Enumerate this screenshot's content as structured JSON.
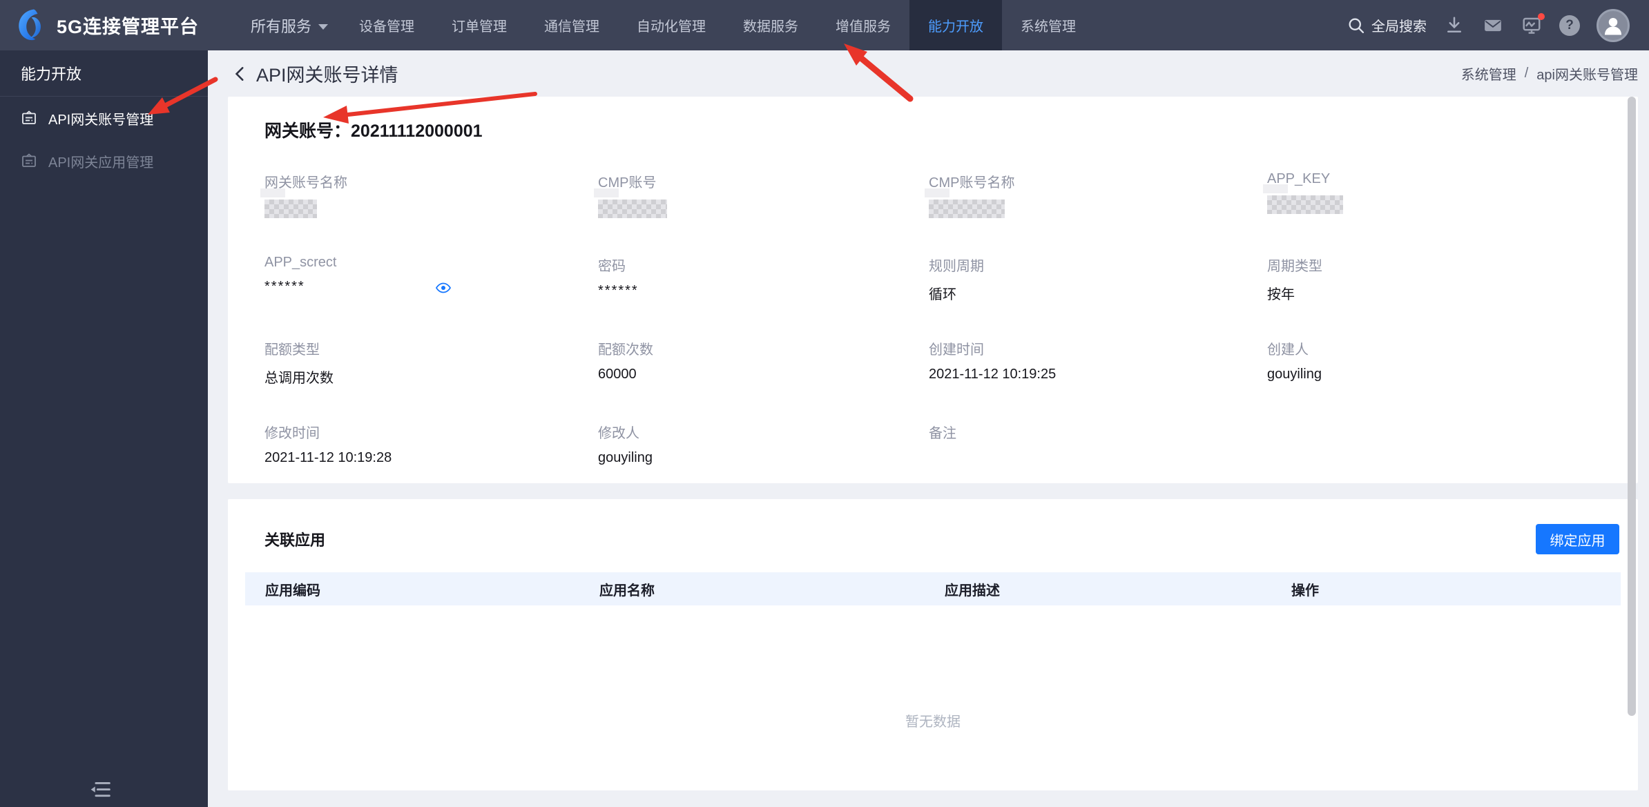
{
  "nav": {
    "brand": "5G连接管理平台",
    "items": [
      {
        "label": "所有服务",
        "has_dropdown": true,
        "active": false
      },
      {
        "label": "设备管理",
        "active": false
      },
      {
        "label": "订单管理",
        "active": false
      },
      {
        "label": "通信管理",
        "active": false
      },
      {
        "label": "自动化管理",
        "active": false
      },
      {
        "label": "数据服务",
        "active": false
      },
      {
        "label": "增值服务",
        "active": false
      },
      {
        "label": "能力开放",
        "active": true
      },
      {
        "label": "系统管理",
        "active": false
      }
    ],
    "search_label": "全局搜索",
    "action_icons": [
      {
        "name": "download-icon"
      },
      {
        "name": "mail-icon"
      },
      {
        "name": "monitor-icon",
        "badge": true
      },
      {
        "name": "help-icon"
      },
      {
        "name": "avatar"
      }
    ]
  },
  "sidebar": {
    "header": "能力开放",
    "items": [
      {
        "label": "API网关账号管理",
        "active": true
      },
      {
        "label": "API网关应用管理",
        "active": false
      }
    ]
  },
  "page": {
    "back_title": "API网关账号详情",
    "breadcrumb": [
      "系统管理",
      "api网关账号管理"
    ],
    "breadcrumb_separator": "/"
  },
  "detail": {
    "title_label": "网关账号：",
    "title_value": "20211112000001",
    "fields": [
      {
        "label": "网关账号名称",
        "type": "redacted"
      },
      {
        "label": "CMP账号",
        "type": "redacted"
      },
      {
        "label": "CMP账号名称",
        "type": "redacted"
      },
      {
        "label": "APP_KEY",
        "type": "redacted"
      },
      {
        "label": "APP_screct",
        "value": "******",
        "type": "masked-eye"
      },
      {
        "label": "密码",
        "value": "******",
        "type": "masked"
      },
      {
        "label": "规则周期",
        "value": "循环",
        "type": "text"
      },
      {
        "label": "周期类型",
        "value": "按年",
        "type": "text"
      },
      {
        "label": "配额类型",
        "value": "总调用次数",
        "type": "text"
      },
      {
        "label": "配额次数",
        "value": "60000",
        "type": "text"
      },
      {
        "label": "创建时间",
        "value": "2021-11-12 10:19:25",
        "type": "text"
      },
      {
        "label": "创建人",
        "value": "gouyiling",
        "type": "text"
      },
      {
        "label": "修改时间",
        "value": "2021-11-12 10:19:28",
        "type": "text"
      },
      {
        "label": "修改人",
        "value": "gouyiling",
        "type": "text"
      },
      {
        "label": "备注",
        "value": "",
        "type": "text"
      }
    ]
  },
  "related": {
    "title": "关联应用",
    "bind_button": "绑定应用",
    "columns": [
      "应用编码",
      "应用名称",
      "应用描述",
      "操作"
    ],
    "rows": [],
    "empty_text": "暂无数据"
  },
  "colors": {
    "accent_blue": "#1677ff",
    "nav_active_text": "#4d9dff",
    "annotation_red": "#e8352a",
    "notification_red": "#ff4a43"
  }
}
